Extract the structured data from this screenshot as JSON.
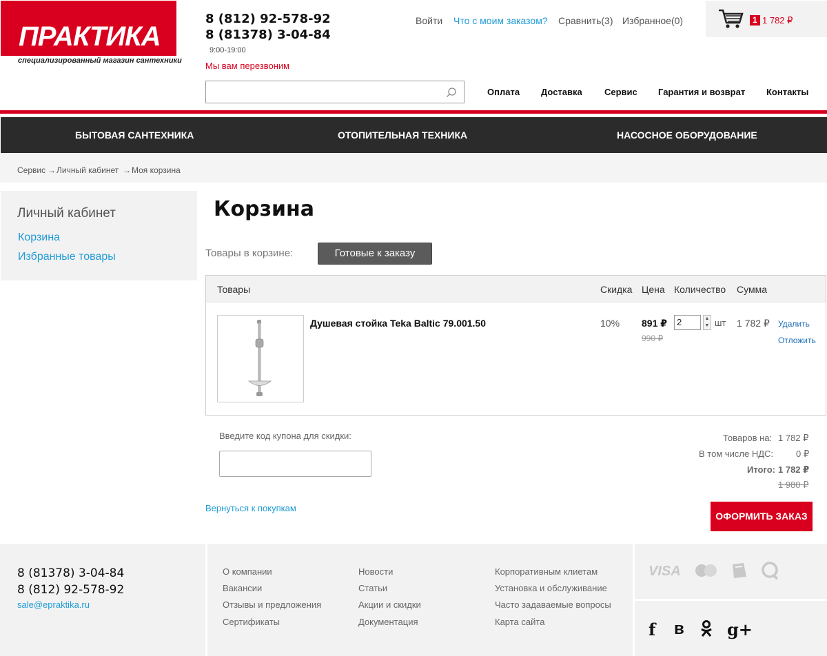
{
  "header": {
    "logo": "ПРАКТИКА",
    "tagline": "специализированный магазин сантехники",
    "phone1": "8 (812) 92-578-92",
    "phone2": "8 (81378) 3-04-84",
    "hours": "9:00-19:00",
    "callback": "Мы вам перезвоним",
    "links": {
      "login": "Войти",
      "order_status": "Что с моим заказом?",
      "compare": "Сравнить(3)",
      "favorites": "Избранное(0)"
    },
    "cart": {
      "count": "1",
      "sum": "1 782 ₽"
    },
    "nav": [
      "Оплата",
      "Доставка",
      "Сервис",
      "Гарантия и возврат",
      "Контакты"
    ]
  },
  "categories": [
    "Бытовая сантехника",
    "Отопительная техника",
    "Насосное оборудование"
  ],
  "breadcrumb": [
    "Сервис",
    "Личный кабинет",
    "Моя корзина"
  ],
  "sidebar": {
    "title": "Личный кабинет",
    "items": [
      "Корзина",
      "Избранные товары"
    ]
  },
  "main": {
    "title": "Корзина",
    "goods_label": "Товары в корзине:",
    "tab_ready": "Готовые к заказу",
    "columns": [
      "Товары",
      "Скидка",
      "Цена",
      "Количество",
      "Сумма"
    ],
    "item": {
      "name": "Душевая стойка Teka Baltic 79.001.50",
      "discount": "10%",
      "price": "891 ₽",
      "old_price": "990 ₽",
      "qty": "2",
      "unit": "шт",
      "sum": "1 782 ₽",
      "delete": "Удалить",
      "postpone": "Отложить"
    },
    "coupon_label": "Введите код купона для скидки:",
    "back_link": "Вернуться к покупкам",
    "totals": {
      "goods_label": "Товаров на:",
      "goods_value": "1 782 ₽",
      "vat_label": "В том числе НДС:",
      "vat_value": "0 ₽",
      "total_label": "Итого:",
      "total_value": "1 782 ₽",
      "total_old": "1 980 ₽"
    },
    "checkout": "ОФОРМИТЬ ЗАКАЗ"
  },
  "footer": {
    "phone1": "8 (81378) 3-04-84",
    "phone2": "8 (812) 92-578-92",
    "email": "sale@epraktika.ru",
    "col1": [
      "О компании",
      "Вакансии",
      "Отзывы и предложения",
      "Сертификаты"
    ],
    "col2": [
      "Новости",
      "Статьи",
      "Акции и скидки",
      "Документация"
    ],
    "col3": [
      "Корпоративным клиетам",
      "Установка и обслуживание",
      "Часто задаваемые вопросы",
      "Карта сайта"
    ],
    "payments": [
      "visa-icon",
      "mastercard-icon",
      "webmoney-icon",
      "qiwi-icon"
    ],
    "social": [
      "f",
      "в",
      "ok",
      "g+"
    ]
  },
  "colors": {
    "brand": "#d8001e",
    "link": "#1e9bd7",
    "dark_bar": "#2b2b2b"
  }
}
